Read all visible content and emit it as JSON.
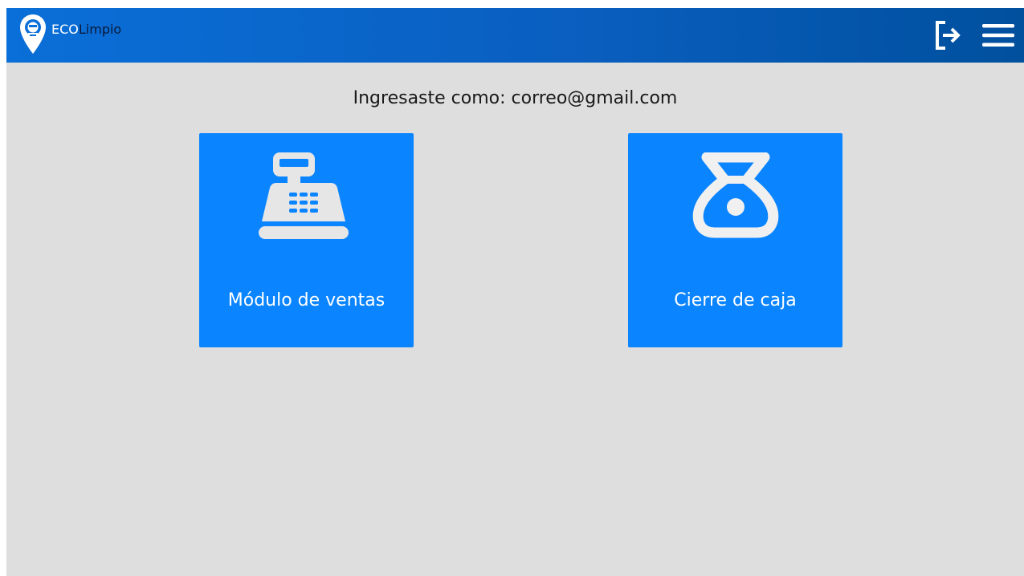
{
  "header": {
    "brand_eco": "ECO",
    "brand_limpio": "Limpio",
    "logout_icon": "logout-icon",
    "menu_icon": "hamburger-menu-icon"
  },
  "main": {
    "welcome_text": "Ingresaste como: correo@gmail.com",
    "tiles": [
      {
        "label": "Módulo de ventas",
        "icon": "cash-register-icon"
      },
      {
        "label": "Cierre de caja",
        "icon": "money-bag-icon"
      }
    ]
  },
  "colors": {
    "header_gradient_start": "#0a6fd8",
    "header_gradient_end": "#00509e",
    "tile_blue": "#0a84ff",
    "page_background": "#dedede"
  }
}
